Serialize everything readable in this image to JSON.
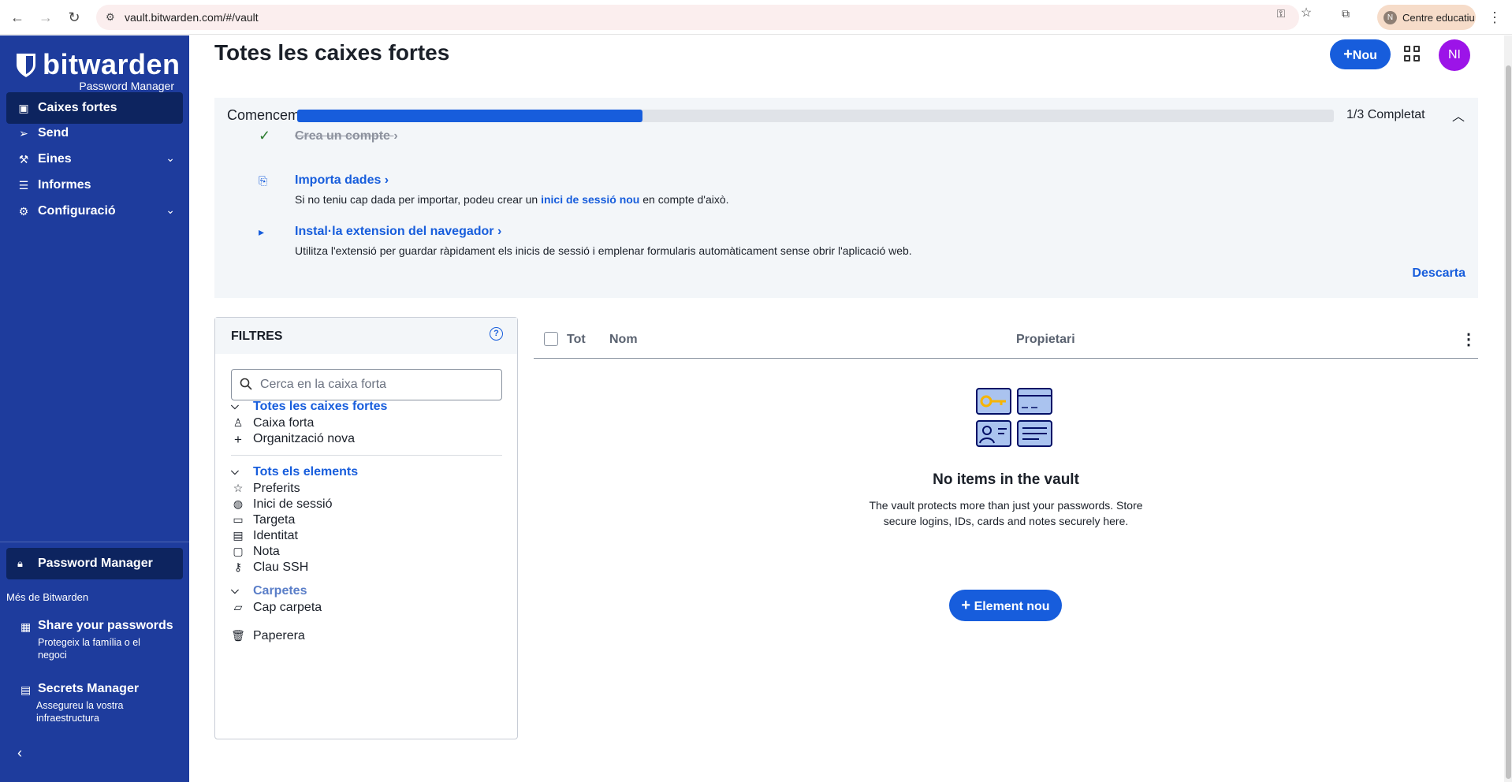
{
  "browser": {
    "url": "vault.bitwarden.com/#/vault",
    "profile_initial": "N",
    "profile_name": "Centre educatiu"
  },
  "sidebar": {
    "logo_word": "bitwarden",
    "logo_sub": "Password Manager",
    "items": [
      {
        "label": "Caixes fortes",
        "icon": "vault-icon",
        "active": true
      },
      {
        "label": "Send",
        "icon": "send-icon"
      },
      {
        "label": "Eines",
        "icon": "wrench-icon",
        "expandable": true
      },
      {
        "label": "Informes",
        "icon": "sliders-icon"
      },
      {
        "label": "Configuració",
        "icon": "gear-icon",
        "expandable": true
      }
    ],
    "product_switch": "Password Manager",
    "more_label": "Més de Bitwarden",
    "promos": [
      {
        "title": "Share your passwords",
        "desc": "Protegeix la família o el negoci",
        "icon": "building-icon"
      },
      {
        "title": "Secrets Manager",
        "desc": "Assegureu la vostra infraestructura",
        "icon": "secrets-icon"
      }
    ]
  },
  "header": {
    "title": "Totes les caixes fortes",
    "new_label": "Nou",
    "avatar_initials": "NI"
  },
  "getting_started": {
    "title": "Comencem",
    "progress_fraction": 0.333,
    "count_label": "1/3 Completat",
    "steps": [
      {
        "label": "Crea un compte",
        "done": true
      },
      {
        "label": "Importa dades",
        "desc_pre": "Si no teniu cap dada per importar, podeu crear un ",
        "desc_link": "inici de sessió nou",
        "desc_post": " en compte d'això."
      },
      {
        "label": "Instal·la extension del navegador",
        "desc": "Utilitza l'extensió per guardar ràpidament els inicis de sessió i emplenar formularis automàticament sense obrir l'aplicació web."
      }
    ],
    "dismiss": "Descarta"
  },
  "filters": {
    "title": "FILTRES",
    "search_placeholder": "Cerca en la caixa forta",
    "vaults_group": "Totes les caixes fortes",
    "vault_items": [
      "Caixa forta",
      "Organització nova"
    ],
    "items_group": "Tots els elements",
    "type_items": [
      "Preferits",
      "Inici de sessió",
      "Targeta",
      "Identitat",
      "Nota",
      "Clau SSH"
    ],
    "folders_group": "Carpetes",
    "folder_items": [
      "Cap carpeta"
    ],
    "trash": "Paperera"
  },
  "table": {
    "col_all": "Tot",
    "col_name": "Nom",
    "col_owner": "Propietari"
  },
  "empty_state": {
    "heading": "No items in the vault",
    "desc": "The vault protects more than just your passwords. Store secure logins, IDs, cards and notes securely here.",
    "button": "Element nou"
  },
  "colors": {
    "sidebar": "#1e3c9d",
    "accent": "#175ddc",
    "avatar": "#9c14e8"
  }
}
